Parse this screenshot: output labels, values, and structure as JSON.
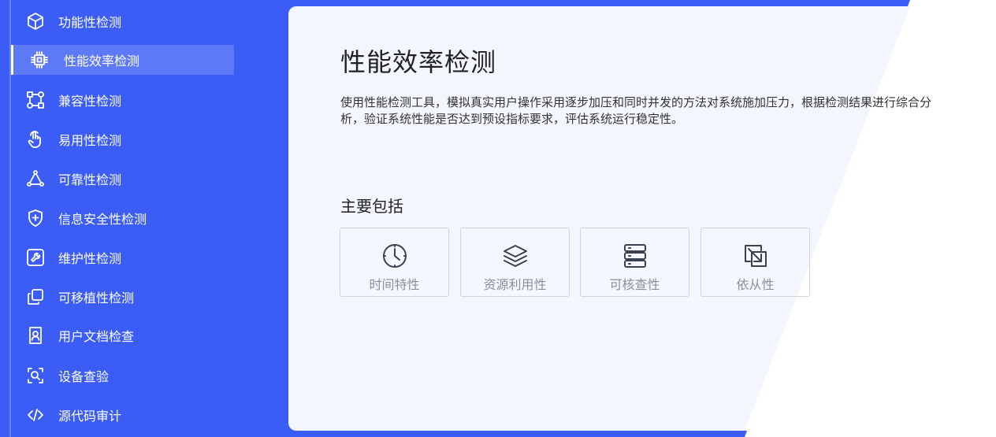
{
  "sidebar": {
    "items": [
      {
        "label": "功能性检测",
        "icon": "cube-icon",
        "active": false
      },
      {
        "label": "性能效率检测",
        "icon": "chip-icon",
        "active": true
      },
      {
        "label": "兼容性检测",
        "icon": "nodes-icon",
        "active": false
      },
      {
        "label": "易用性检测",
        "icon": "hand-pointer-icon",
        "active": false
      },
      {
        "label": "可靠性检测",
        "icon": "triangle-nodes-icon",
        "active": false
      },
      {
        "label": "信息安全性检测",
        "icon": "shield-plus-icon",
        "active": false
      },
      {
        "label": "维护性检测",
        "icon": "wrench-icon",
        "active": false
      },
      {
        "label": "可移植性检测",
        "icon": "copy-icon",
        "active": false
      },
      {
        "label": "用户文档检查",
        "icon": "user-doc-icon",
        "active": false
      },
      {
        "label": "设备查验",
        "icon": "scan-search-icon",
        "active": false
      },
      {
        "label": "源代码审计",
        "icon": "code-icon",
        "active": false
      }
    ]
  },
  "main": {
    "title": "性能效率检测",
    "description": "使用性能检测工具，模拟真实用户操作采用逐步加压和同时并发的方法对系统施加压力，根据检测结果进行综合分析，验证系统性能是否达到预设指标要求，评估系统运行稳定性。",
    "subtitle": "主要包括",
    "features": [
      {
        "label": "时间特性",
        "icon": "clock-icon"
      },
      {
        "label": "资源利用性",
        "icon": "layers-icon"
      },
      {
        "label": "可核查性",
        "icon": "server-icon"
      },
      {
        "label": "依从性",
        "icon": "arrow-box-icon"
      }
    ]
  },
  "colors": {
    "sidebar_bg": "#3b5cf5",
    "panel_bg": "#f3f6fd",
    "text_dark": "#222222",
    "card_label": "#8a8f99"
  }
}
